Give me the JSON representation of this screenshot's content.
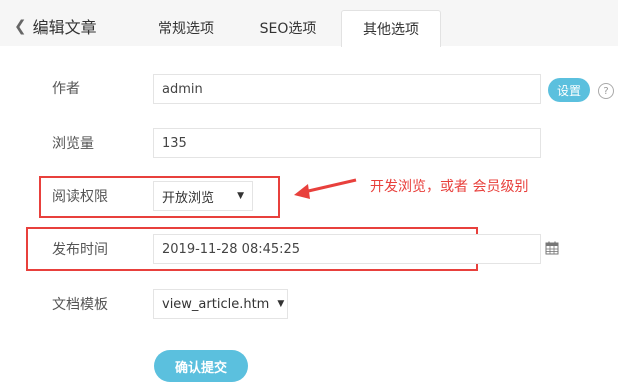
{
  "header": {
    "back_label": "编辑文章",
    "tabs": [
      {
        "label": "常规选项"
      },
      {
        "label": "SEO选项"
      },
      {
        "label": "其他选项"
      }
    ]
  },
  "form": {
    "author": {
      "label": "作者",
      "value": "admin",
      "button": "设置",
      "help": "?"
    },
    "views": {
      "label": "浏览量",
      "value": "135"
    },
    "permission": {
      "label": "阅读权限",
      "selected": "开放浏览"
    },
    "publish_time": {
      "label": "发布时间",
      "value": "2019-11-28 08:45:25"
    },
    "template": {
      "label": "文档模板",
      "selected": "view_article.htm"
    },
    "submit_label": "确认提交"
  },
  "annotation": {
    "text": "开发浏览，或者 会员级别",
    "color": "#e8403c"
  },
  "colors": {
    "accent": "#5bc0de",
    "highlight": "#e8403c"
  },
  "icons": {
    "back": "chevron-left-icon",
    "calendar": "calendar-icon",
    "help": "question-icon",
    "arrow": "arrow-left-icon"
  }
}
